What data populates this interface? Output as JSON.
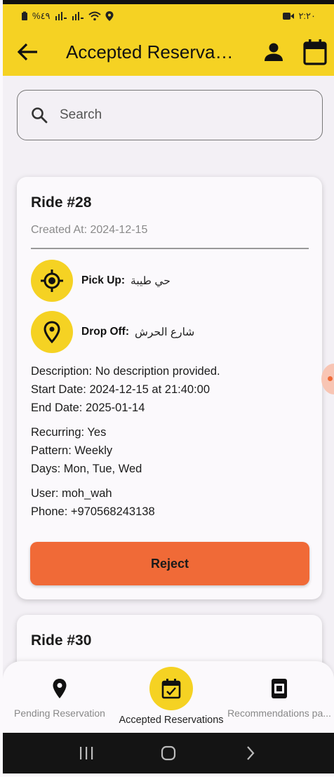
{
  "status_bar": {
    "left_text": "%٤٩",
    "time": "٢:٢٠"
  },
  "app_bar": {
    "title": "Accepted Reserva…",
    "back_icon": "arrow-back-icon",
    "profile_icon": "person-icon",
    "calendar_icon": "calendar-icon"
  },
  "search": {
    "placeholder": "Search",
    "value": ""
  },
  "cards": [
    {
      "title": "Ride #28",
      "created": "Created At: 2024-12-15",
      "pickup_label": "Pick Up:",
      "pickup_value": "حي طيبة",
      "dropoff_label": "Drop Off:",
      "dropoff_value": "شارع الحرش",
      "description": "Description: No description provided.",
      "start_date": "Start Date: 2024-12-15 at 21:40:00",
      "end_date": "End Date: 2025-01-14",
      "recurring": "Recurring: Yes",
      "pattern": "Pattern: Weekly",
      "days": "Days: Mon, Tue, Wed",
      "user": "User: moh_wah",
      "phone": "Phone: +970568243138",
      "reject_label": "Reject"
    },
    {
      "title": "Ride #30"
    }
  ],
  "bottom_nav": {
    "items": [
      {
        "label": "Pending Reservation",
        "icon": "location-pin-icon"
      },
      {
        "label": "Accepted Reservations",
        "icon": "calendar-check-icon",
        "active": true
      },
      {
        "label": "Recommendations pa...",
        "icon": "recommendations-icon"
      }
    ]
  },
  "colors": {
    "primary": "#f5d223",
    "reject": "#f06a37",
    "background": "#f3f0f5"
  }
}
